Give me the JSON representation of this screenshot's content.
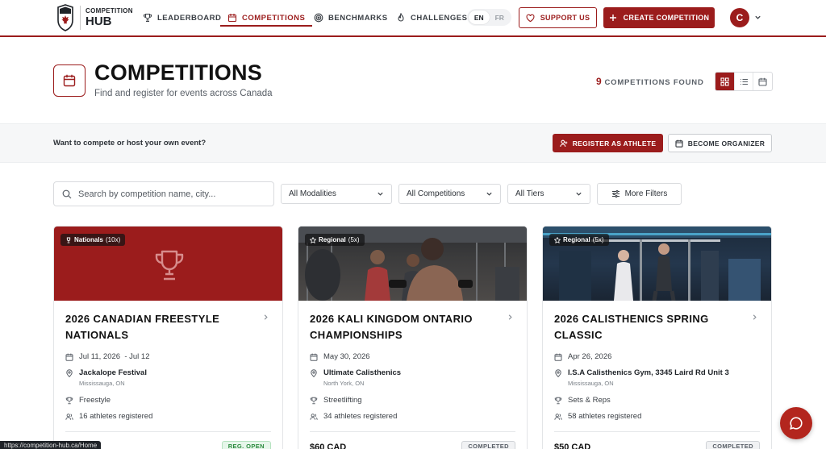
{
  "brand": {
    "line1": "COMPETITION",
    "line2": "HUB"
  },
  "nav": {
    "items": [
      {
        "label": "LEADERBOARD",
        "icon": "trophy-icon"
      },
      {
        "label": "COMPETITIONS",
        "icon": "calendar-icon",
        "active": true
      },
      {
        "label": "BENCHMARKS",
        "icon": "target-icon"
      },
      {
        "label": "CHALLENGES",
        "icon": "flame-icon"
      }
    ],
    "lang": {
      "en": "EN",
      "fr": "FR",
      "selected": "EN"
    },
    "support_label": "SUPPORT US",
    "create_label": "CREATE COMPETITION",
    "avatar_initial": "C"
  },
  "header": {
    "title": "COMPETITIONS",
    "subtitle": "Find and register for events across Canada",
    "found_count": "9",
    "found_label": "COMPETITIONS FOUND",
    "views": [
      "grid-icon",
      "list-icon",
      "calendar-icon"
    ],
    "active_view": "grid"
  },
  "banner": {
    "text": "Want to compete or host your own event?",
    "register_label": "REGISTER AS ATHLETE",
    "organizer_label": "BECOME ORGANIZER"
  },
  "filters": {
    "search_placeholder": "Search by competition name, city...",
    "modalities": "All Modalities",
    "competitions": "All Competitions",
    "tiers": "All Tiers",
    "more": "More Filters"
  },
  "cards": [
    {
      "tier": "Nationals",
      "tier_count": "(10x)",
      "title": "2026 CANADIAN FREESTYLE NATIONALS",
      "dates": "Jul 11, 2026  - Jul 12",
      "venue": "Jackalope Festival",
      "city": "Mississauga, ON",
      "modality": "Freestyle",
      "athletes": "16 athletes registered",
      "price": "",
      "status": "REG. OPEN"
    },
    {
      "tier": "Regional",
      "tier_count": "(5x)",
      "title": "2026 KALI KINGDOM ONTARIO CHAMPIONSHIPS",
      "dates": "May 30, 2026",
      "venue": "Ultimate Calisthenics",
      "city": "North York, ON",
      "modality": "Streetlifting",
      "athletes": "34 athletes registered",
      "price": "$60 CAD",
      "status": "COMPLETED"
    },
    {
      "tier": "Regional",
      "tier_count": "(5x)",
      "title": "2026 CALISTHENICS SPRING CLASSIC",
      "dates": "Apr 26, 2026",
      "venue": "I.S.A Calisthenics Gym, 3345 Laird Rd Unit 3",
      "city": "Mississauga, ON",
      "modality": "Sets & Reps",
      "athletes": "58 athletes registered",
      "price": "$50 CAD",
      "status": "COMPLETED"
    }
  ],
  "status_url": "https://competition-hub.ca/Home",
  "colors": {
    "accent": "#9b1c1c",
    "chat": "#b3261e"
  }
}
